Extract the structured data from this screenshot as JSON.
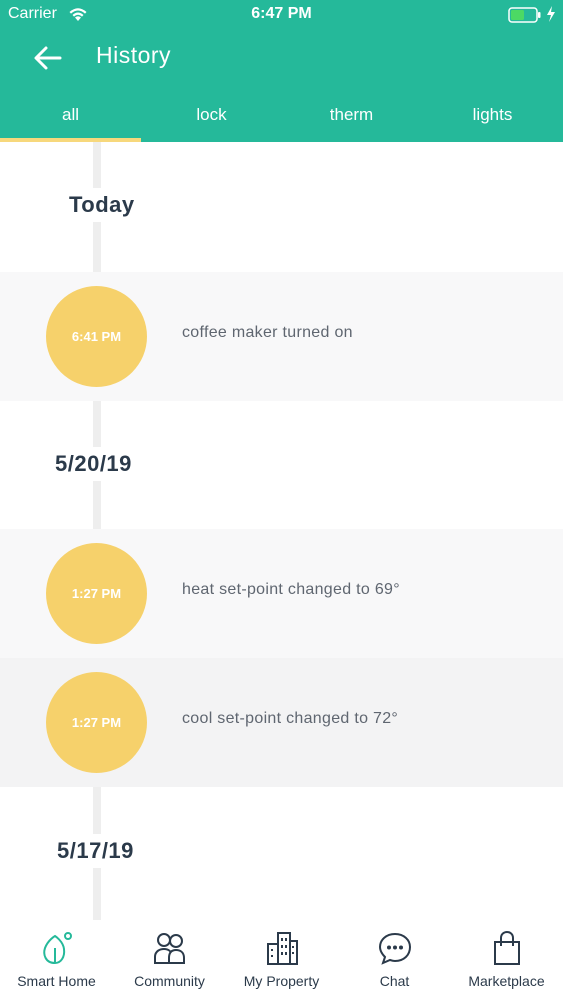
{
  "status_bar": {
    "carrier": "Carrier",
    "time": "6:47 PM"
  },
  "header": {
    "title": "History",
    "background_color": "#25b99a",
    "accent_color": "#f7d87c"
  },
  "tabs": [
    {
      "label": "all",
      "selected": true
    },
    {
      "label": "lock",
      "selected": false
    },
    {
      "label": "therm",
      "selected": false
    },
    {
      "label": "lights",
      "selected": false
    }
  ],
  "history": {
    "groups": [
      {
        "date": "Today",
        "events": [
          {
            "time": "6:41 PM",
            "text": "coffee maker turned on"
          }
        ]
      },
      {
        "date": "5/20/19",
        "events": [
          {
            "time": "1:27 PM",
            "text": "heat set-point changed to 69°"
          },
          {
            "time": "1:27 PM",
            "text": "cool set-point changed to 72°"
          }
        ]
      },
      {
        "date": "5/17/19",
        "events": []
      }
    ],
    "circle_color": "#f6d16b"
  },
  "bottom_nav": {
    "items": [
      {
        "label": "Smart Home",
        "icon": "smart-home-leaf-icon",
        "active": true
      },
      {
        "label": "Community",
        "icon": "community-people-icon",
        "active": false
      },
      {
        "label": "My Property",
        "icon": "building-icon",
        "active": false
      },
      {
        "label": "Chat",
        "icon": "chat-bubble-icon",
        "active": false
      },
      {
        "label": "Marketplace",
        "icon": "shopping-bag-icon",
        "active": false
      }
    ]
  }
}
